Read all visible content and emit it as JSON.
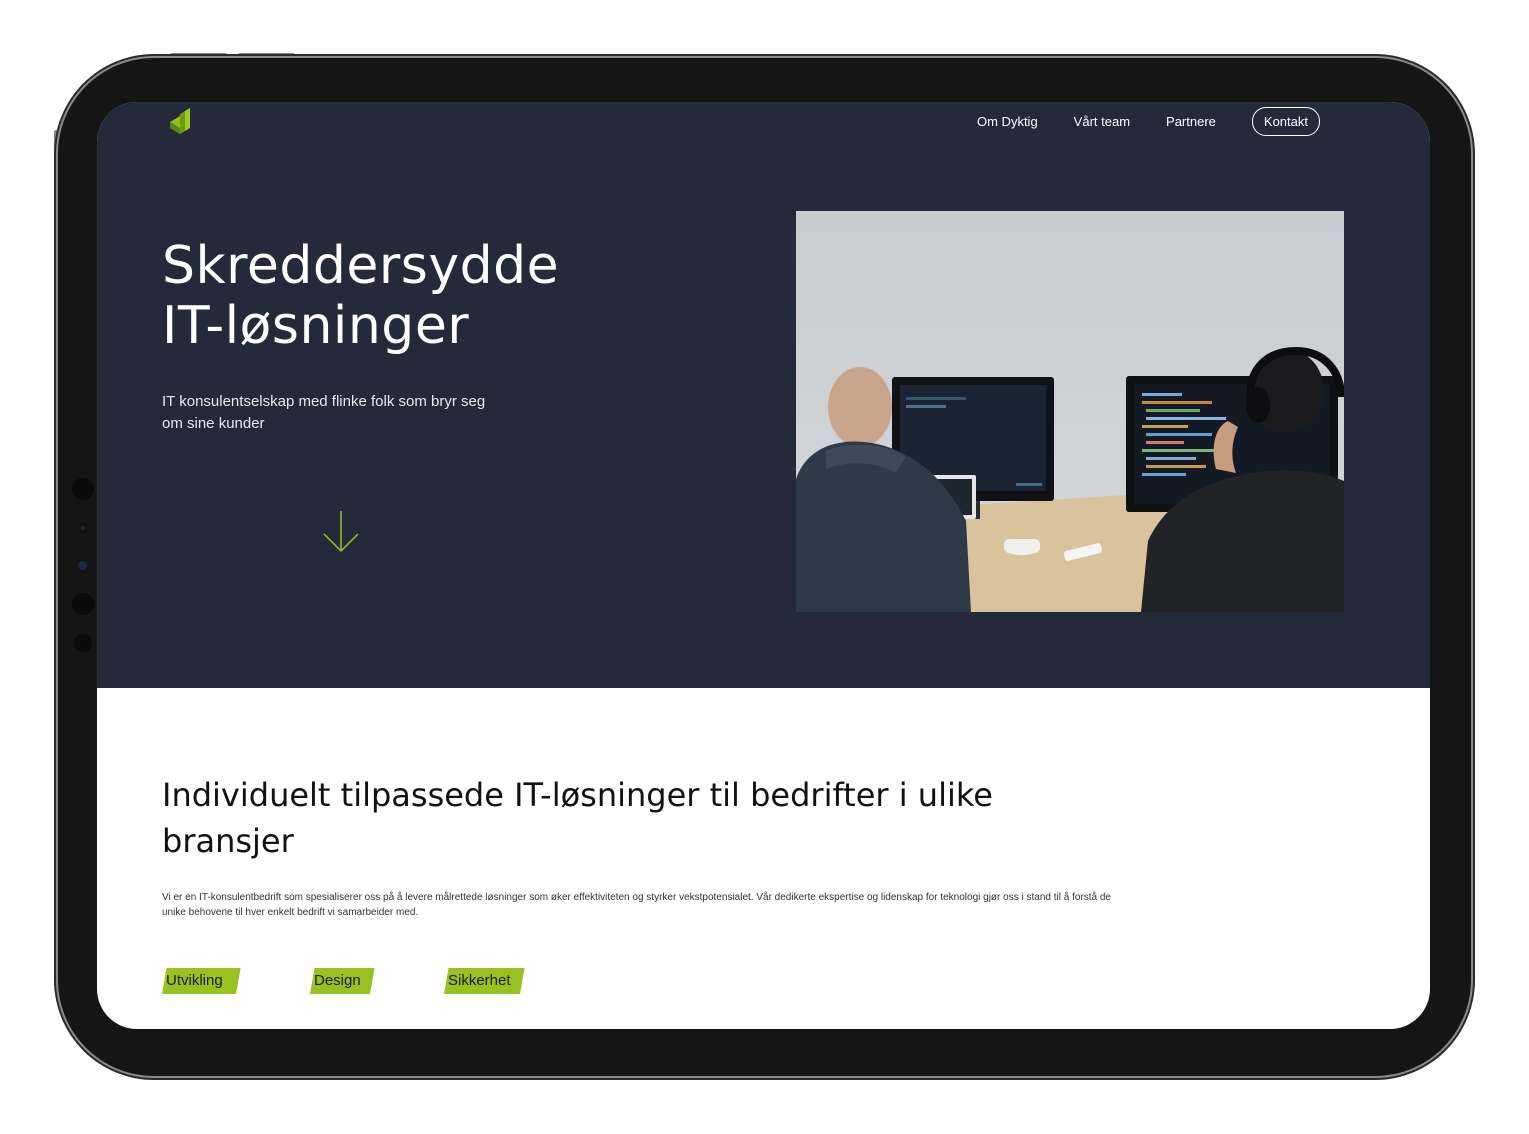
{
  "nav": {
    "items": [
      "Om Dyktig",
      "Vårt team",
      "Partnere"
    ],
    "contact_label": "Kontakt"
  },
  "hero": {
    "title_line1": "Skreddersydde",
    "title_line2": "IT-løsninger",
    "subtitle": "IT konsulentselskap med flinke folk som bryr seg om sine kunder"
  },
  "section": {
    "title": "Individuelt tilpassede IT-løsninger til bedrifter i ulike bransjer",
    "body": "Vi er en IT-konsulentbedrift som spesialiserer oss på å levere målrettede løsninger som øker effektiviteten og styrker vekstpotensialet. Vår dedikerte ekspertise og lidenskap for teknologi gjør oss i stand til å forstå de unike behovene til hver enkelt bedrift vi samarbeider med.",
    "tags": [
      "Utvikling",
      "Design",
      "Sikkerhet"
    ]
  },
  "colors": {
    "hero_bg": "#252a3b",
    "accent": "#98c21f",
    "text_light": "#ffffff"
  },
  "icons": {
    "logo": "dyktig-logo",
    "scroll": "arrow-down-icon"
  }
}
